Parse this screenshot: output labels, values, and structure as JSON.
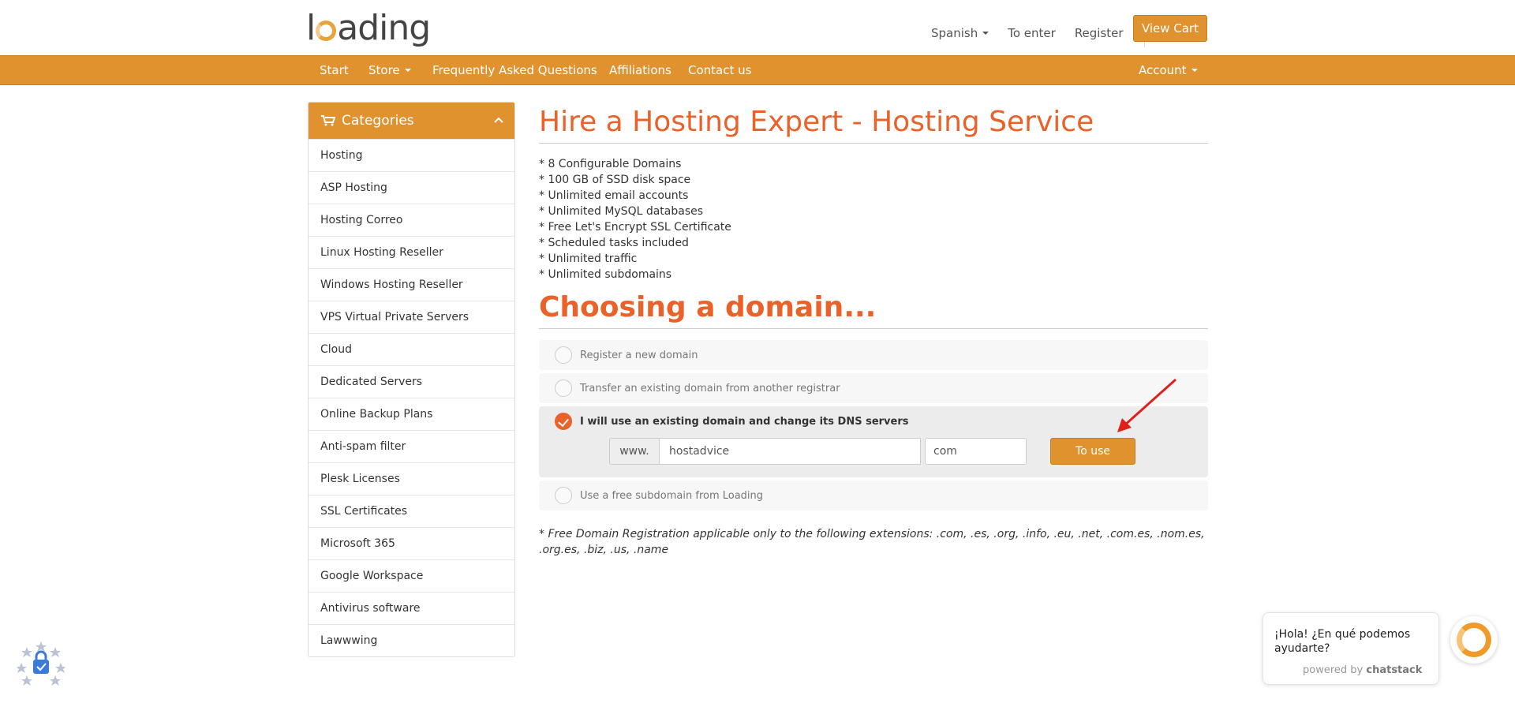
{
  "header": {
    "logo": {
      "pre": "l",
      "post": "ading"
    },
    "language": "Spanish",
    "login": "To enter",
    "register": "Register",
    "cart": "View Cart"
  },
  "nav": {
    "items": [
      {
        "label": "Start"
      },
      {
        "label": "Store"
      },
      {
        "label": "Frequently Asked Questions"
      },
      {
        "label": "Affiliations"
      },
      {
        "label": "Contact us"
      }
    ],
    "account": "Account"
  },
  "sidebar": {
    "title": "Categories",
    "items": [
      "Hosting",
      "ASP Hosting",
      "Hosting Correo",
      "Linux Hosting Reseller",
      "Windows Hosting Reseller",
      "VPS Virtual Private Servers",
      "Cloud",
      "Dedicated Servers",
      "Online Backup Plans",
      "Anti-spam filter",
      "Plesk Licenses",
      "SSL Certificates",
      "Microsoft 365",
      "Google Workspace",
      "Antivirus software",
      "Lawwwing"
    ]
  },
  "main": {
    "title": "Hire a Hosting Expert - Hosting Service",
    "features": [
      "* 8 Configurable Domains",
      "* 100 GB of SSD disk space",
      "* Unlimited email accounts",
      "* Unlimited MySQL databases",
      "* Free Let's Encrypt SSL Certificate",
      "* Scheduled tasks included",
      "* Unlimited traffic",
      "* Unlimited subdomains"
    ],
    "domain_heading": "Choosing a domain...",
    "options": {
      "register": "Register a new domain",
      "transfer": "Transfer an existing domain from another registrar",
      "owndomain": "I will use an existing domain and change its DNS servers",
      "subdomain": "Use a free subdomain from Loading"
    },
    "selected_option": "owndomain",
    "domain_form": {
      "prefix": "www.",
      "sld_value": "hostadvice",
      "tld_value": "com",
      "button": "To use"
    },
    "note": "* Free Domain Registration applicable only to the following extensions: .com, .es, .org, .info, .eu, .net, .com.es, .nom.es, .org.es, .biz, .us, .name"
  },
  "chat": {
    "message": "¡Hola! ¿En qué podemos ayudarte?",
    "powered_prefix": "powered by",
    "powered_brand": "chatstack"
  },
  "colors": {
    "accent": "#e0922f",
    "heading": "#e8622a",
    "arrow": "#e0201b"
  }
}
